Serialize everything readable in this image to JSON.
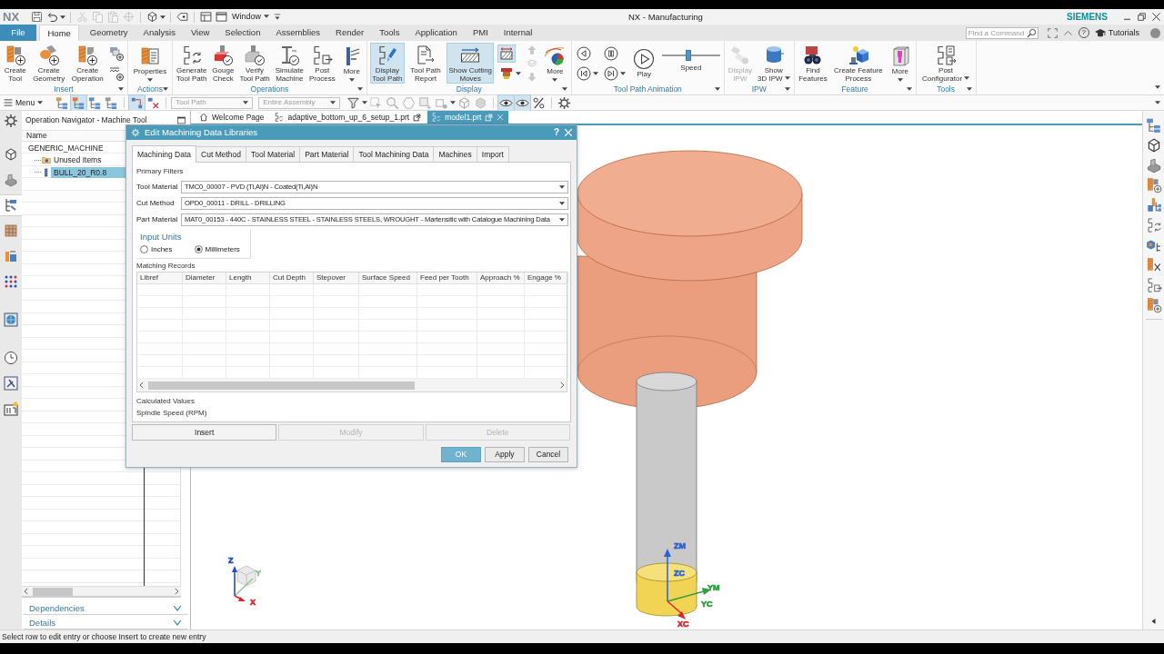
{
  "title_bar": {
    "logo": "NX",
    "quick_access": [
      {
        "kind": "icon",
        "disabled": false,
        "menu": false
      },
      {
        "kind": "icon",
        "disabled": false,
        "menu": true
      },
      {
        "kind": "sep"
      },
      {
        "kind": "icon",
        "disabled": true,
        "menu": false
      },
      {
        "kind": "icon",
        "disabled": true,
        "menu": false
      },
      {
        "kind": "icon",
        "disabled": true,
        "menu": false
      },
      {
        "kind": "icon",
        "disabled": true,
        "menu": false
      },
      {
        "kind": "sep"
      },
      {
        "kind": "icon",
        "disabled": false,
        "menu": true
      },
      {
        "kind": "sep"
      },
      {
        "kind": "icon",
        "disabled": false,
        "menu": false
      },
      {
        "kind": "sep"
      },
      {
        "kind": "icon",
        "disabled": false,
        "menu": false
      },
      {
        "kind": "icon",
        "disabled": false,
        "menu": false
      }
    ],
    "window_menu": "Window",
    "title": "NX - Manufacturing",
    "brand": "SIEMENS"
  },
  "menu_tabs": [
    {
      "label": "File",
      "kind": "file",
      "selected": false
    },
    {
      "label": "Home",
      "kind": "tab",
      "selected": true
    },
    {
      "label": "Geometry",
      "kind": "tab",
      "selected": false
    },
    {
      "label": "Analysis",
      "kind": "tab",
      "selected": false
    },
    {
      "label": "View",
      "kind": "tab",
      "selected": false
    },
    {
      "label": "Selection",
      "kind": "tab",
      "selected": false
    },
    {
      "label": "Assemblies",
      "kind": "tab",
      "selected": false
    },
    {
      "label": "Render",
      "kind": "tab",
      "selected": false
    },
    {
      "label": "Tools",
      "kind": "tab",
      "selected": false
    },
    {
      "label": "Application",
      "kind": "tab",
      "selected": false
    },
    {
      "label": "PMI",
      "kind": "tab",
      "selected": false
    },
    {
      "label": "Internal",
      "kind": "tab",
      "selected": false
    }
  ],
  "help_bar": {
    "search": {
      "placeholder": "Find a Command"
    },
    "help": "?",
    "tutorials": "Tutorials"
  },
  "ribbon": {
    "groups": [
      {
        "label": "Insert",
        "menu": true,
        "buttons": [
          {
            "kind": "large",
            "label": "Create\nTool",
            "on": false,
            "disabled": false,
            "menu": false
          },
          {
            "kind": "large",
            "label": "Create\nGeometry",
            "on": false,
            "disabled": false,
            "menu": false
          },
          {
            "kind": "large",
            "label": "Create\nOperation",
            "on": false,
            "disabled": false,
            "menu": false
          },
          {
            "kind": "stack",
            "buttons": [
              {
                "kind": "small",
                "on": false,
                "disabled": false,
                "menu": false
              },
              {
                "kind": "small",
                "on": false,
                "disabled": false,
                "menu": false
              }
            ]
          }
        ]
      },
      {
        "label": "Actions",
        "menu": true,
        "buttons": [
          {
            "kind": "large",
            "label": "Properties",
            "on": false,
            "disabled": false,
            "menu": true
          }
        ]
      },
      {
        "label": "Operations",
        "menu": true,
        "buttons": [
          {
            "kind": "large",
            "label": "Generate\nTool Path",
            "on": false,
            "disabled": false,
            "menu": false
          },
          {
            "kind": "large",
            "label": "Gouge\nCheck",
            "on": false,
            "disabled": false,
            "menu": false
          },
          {
            "kind": "large",
            "label": "Verify\nTool Path",
            "on": false,
            "disabled": false,
            "menu": false
          },
          {
            "kind": "large",
            "label": "Simulate\nMachine",
            "on": false,
            "disabled": false,
            "menu": false
          },
          {
            "kind": "large",
            "label": "Post\nProcess",
            "on": false,
            "disabled": false,
            "menu": false
          },
          {
            "kind": "large",
            "label": "More",
            "on": false,
            "disabled": false,
            "menu": true
          }
        ]
      },
      {
        "label": "Display",
        "menu": true,
        "buttons": [
          {
            "kind": "large",
            "label": "Display\nTool Path",
            "on": true,
            "disabled": false,
            "menu": false
          },
          {
            "kind": "large",
            "label": "Tool Path\nReport",
            "on": false,
            "disabled": false,
            "menu": false
          },
          {
            "kind": "large",
            "label": "Show Cutting\nMoves",
            "on": true,
            "disabled": false,
            "menu": false
          },
          {
            "kind": "stack",
            "buttons": [
              {
                "kind": "small",
                "on": true,
                "disabled": false,
                "menu": false
              },
              {
                "kind": "small",
                "on": false,
                "disabled": false,
                "menu": true
              }
            ]
          },
          {
            "kind": "stack",
            "buttons": [
              {
                "kind": "small",
                "on": false,
                "disabled": true,
                "menu": false
              },
              {
                "kind": "small",
                "on": false,
                "disabled": true,
                "menu": false
              },
              {
                "kind": "small",
                "on": false,
                "disabled": true,
                "menu": false
              }
            ]
          },
          {
            "kind": "large",
            "label": "More",
            "on": false,
            "disabled": false,
            "menu": true
          }
        ]
      },
      {
        "label": "Tool Path Animation",
        "menu": true,
        "buttons": [
          {
            "kind": "stack",
            "buttons": [
              {
                "kind": "small",
                "on": false,
                "disabled": false,
                "menu": false
              },
              {
                "kind": "small",
                "on": false,
                "disabled": false,
                "menu": true
              }
            ]
          },
          {
            "kind": "stack",
            "buttons": [
              {
                "kind": "small",
                "on": false,
                "disabled": false,
                "menu": false
              },
              {
                "kind": "small",
                "on": false,
                "disabled": false,
                "menu": true
              }
            ]
          },
          {
            "kind": "large",
            "label": "Play",
            "on": false,
            "disabled": false,
            "menu": false
          },
          {
            "kind": "slider",
            "label": "Speed",
            "level": 0.45
          }
        ]
      },
      {
        "label": "IPW",
        "menu": true,
        "buttons": [
          {
            "kind": "large",
            "label": "Display\nIPW",
            "on": false,
            "disabled": true,
            "menu": false
          },
          {
            "kind": "large",
            "label": "Show\n3D IPW",
            "on": false,
            "disabled": false,
            "menu": true
          }
        ]
      },
      {
        "label": "Feature",
        "menu": true,
        "buttons": [
          {
            "kind": "large",
            "label": "Find\nFeatures",
            "on": false,
            "disabled": false,
            "menu": false
          },
          {
            "kind": "large",
            "label": "Create Feature\nProcess",
            "on": false,
            "disabled": false,
            "menu": false
          },
          {
            "kind": "large",
            "label": "More",
            "on": false,
            "disabled": false,
            "menu": true
          }
        ]
      },
      {
        "label": "Tools",
        "menu": true,
        "buttons": [
          {
            "kind": "large",
            "label": "Post\nConfigurator",
            "on": false,
            "disabled": false,
            "menu": true
          }
        ]
      }
    ]
  },
  "toolbar": {
    "menu": "Menu",
    "items": [
      {
        "kind": "icon",
        "on": false,
        "disabled": false,
        "menu": false
      },
      {
        "kind": "icon",
        "on": true,
        "disabled": false,
        "menu": false
      },
      {
        "kind": "icon",
        "on": false,
        "disabled": false,
        "menu": false
      },
      {
        "kind": "icon",
        "on": false,
        "disabled": false,
        "menu": false
      },
      {
        "kind": "sep"
      },
      {
        "kind": "icon",
        "on": true,
        "disabled": false,
        "menu": false
      },
      {
        "kind": "icon",
        "on": false,
        "disabled": false,
        "menu": false
      },
      {
        "kind": "sep"
      },
      {
        "kind": "select",
        "value": "Tool Path",
        "disabled": true
      },
      {
        "kind": "select",
        "value": "Entire Assembly",
        "disabled": true
      },
      {
        "kind": "icon",
        "on": false,
        "disabled": false,
        "menu": true
      },
      {
        "kind": "icon",
        "on": false,
        "disabled": true,
        "menu": false
      },
      {
        "kind": "icon",
        "on": false,
        "disabled": true,
        "menu": false
      },
      {
        "kind": "icon",
        "on": false,
        "disabled": true,
        "menu": false
      },
      {
        "kind": "icon",
        "on": false,
        "disabled": true,
        "menu": false
      },
      {
        "kind": "icon",
        "on": false,
        "disabled": true,
        "menu": true
      },
      {
        "kind": "icon",
        "on": false,
        "disabled": true,
        "menu": false
      },
      {
        "kind": "icon",
        "on": false,
        "disabled": true,
        "menu": false
      },
      {
        "kind": "sep"
      },
      {
        "kind": "icon",
        "on": true,
        "disabled": false,
        "menu": false
      },
      {
        "kind": "icon",
        "on": true,
        "disabled": false,
        "menu": false
      },
      {
        "kind": "icon",
        "on": false,
        "disabled": false,
        "menu": false
      },
      {
        "kind": "sep"
      },
      {
        "kind": "icon",
        "on": false,
        "disabled": false,
        "menu": false
      }
    ]
  },
  "left_rail": [
    {
      "selected": false
    },
    {
      "selected": false
    },
    {
      "selected": false
    },
    {
      "selected": true
    },
    {
      "selected": false
    },
    {
      "selected": false
    },
    {
      "selected": false
    },
    {
      "selected": false
    },
    {
      "selected": false
    },
    {
      "selected": false
    },
    {
      "selected": false
    }
  ],
  "navigator": {
    "title": "Operation Navigator - Machine Tool",
    "column": "Name",
    "tree": [
      {
        "label": "GENERIC_MACHINE",
        "selected": false,
        "children": [
          {
            "label": "Unused Items",
            "kind": "folder",
            "selected": false
          },
          {
            "label": "BULL_20_R0.8",
            "kind": "tool",
            "selected": true
          }
        ]
      }
    ],
    "sections": [
      {
        "label": "Dependencies",
        "expanded": false
      },
      {
        "label": "Details",
        "expanded": false
      }
    ]
  },
  "doc_tabs": [
    {
      "label": "Welcome Page",
      "kind": "home",
      "selected": false
    },
    {
      "label": "adaptive_bottom_up_6_setup_1.prt",
      "kind": "part",
      "selected": false
    },
    {
      "label": "model1.prt",
      "kind": "part",
      "selected": true
    }
  ],
  "viewport": {
    "view_triad": [
      {
        "label": "Z",
        "color": "#1f4fd0"
      },
      {
        "label": "X",
        "color": "#d02a2a"
      },
      {
        "label": "Y",
        "color": "#8fbf8f"
      }
    ],
    "work_axes": [
      {
        "label": "ZM",
        "color": "#2a62d8"
      },
      {
        "label": "ZC",
        "color": "#2a62d8"
      },
      {
        "label": "YM",
        "color": "#2e9e3e"
      },
      {
        "label": "YC",
        "color": "#2e9e3e"
      },
      {
        "label": "XC",
        "color": "#d02a2a"
      }
    ]
  },
  "dialog": {
    "title": "Edit Machining Data Libraries",
    "help": "?",
    "tabs": [
      {
        "label": "Machining Data",
        "selected": true
      },
      {
        "label": "Cut Method",
        "selected": false
      },
      {
        "label": "Tool Material",
        "selected": false
      },
      {
        "label": "Part Material",
        "selected": false
      },
      {
        "label": "Tool Machining Data",
        "selected": false
      },
      {
        "label": "Machines",
        "selected": false
      },
      {
        "label": "Import",
        "selected": false
      }
    ],
    "primary_filters": {
      "label": "Primary Filters",
      "fields": [
        {
          "label": "Tool Material",
          "value": "TMC0_00007 - PVD (Ti,Al)N - Coated(Ti,Al)N"
        },
        {
          "label": "Cut Method",
          "value": "OPD0_00011 - DRILL - DRILLING"
        },
        {
          "label": "Part Material",
          "value": "MAT0_00153 - 440C - STAINLESS STEEL - STAINLESS STEELS, WROUGHT - Martensitic with Catalogue Machining Data"
        }
      ]
    },
    "input_units": {
      "label": "Input Units",
      "options": [
        {
          "label": "Inches",
          "selected": false
        },
        {
          "label": "Millimeters",
          "selected": true
        }
      ]
    },
    "matching_records": {
      "label": "Matching Records",
      "columns": [
        "Libref",
        "Diameter",
        "Length",
        "Cut Depth",
        "Stepover",
        "Surface Speed",
        "Feed per Tooth",
        "Approach %",
        "Engage %"
      ]
    },
    "calculated_values": {
      "label": "Calculated Values",
      "fields": [
        "Spindle Speed (RPM)"
      ]
    },
    "actions": [
      {
        "label": "Insert",
        "disabled": false
      },
      {
        "label": "Modify",
        "disabled": true
      },
      {
        "label": "Delete",
        "disabled": true
      }
    ],
    "buttons": [
      {
        "label": "OK",
        "kind": "primary"
      },
      {
        "label": "Apply",
        "kind": "secondary"
      },
      {
        "label": "Cancel",
        "kind": "secondary"
      }
    ]
  },
  "status_bar": {
    "message": "Select row to edit entry or choose Insert to create new entry"
  }
}
